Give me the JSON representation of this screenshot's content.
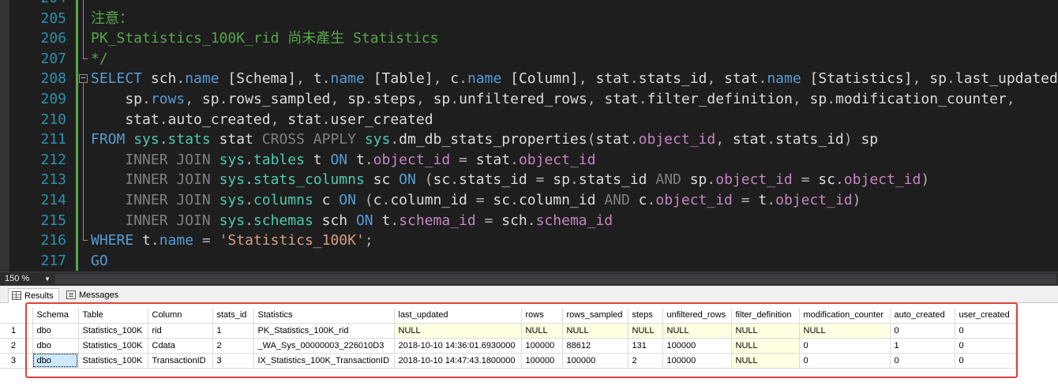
{
  "editor": {
    "lines": [
      {
        "num": "204",
        "fold": "bar",
        "tokens": [
          {
            "c": "c-com",
            "t": ""
          }
        ]
      },
      {
        "num": "205",
        "fold": "bar",
        "tokens": [
          {
            "c": "c-com",
            "t": "注意："
          }
        ]
      },
      {
        "num": "206",
        "fold": "bar",
        "tokens": [
          {
            "c": "c-com",
            "t": "PK_Statistics_100K_rid 尚未產生 Statistics"
          }
        ]
      },
      {
        "num": "207",
        "fold": "end",
        "tokens": [
          {
            "c": "c-com",
            "t": "*/"
          }
        ]
      },
      {
        "num": "208",
        "fold": "box",
        "tokens": [
          {
            "c": "c-kw",
            "t": "SELECT "
          },
          {
            "c": "c-id",
            "t": "sch"
          },
          {
            "c": "c-op",
            "t": "."
          },
          {
            "c": "c-kw",
            "t": "name"
          },
          {
            "c": "c-id",
            "t": " [Schema]"
          },
          {
            "c": "c-op",
            "t": ", "
          },
          {
            "c": "c-id",
            "t": "t"
          },
          {
            "c": "c-op",
            "t": "."
          },
          {
            "c": "c-kw",
            "t": "name"
          },
          {
            "c": "c-id",
            "t": " [Table]"
          },
          {
            "c": "c-op",
            "t": ", "
          },
          {
            "c": "c-id",
            "t": "c"
          },
          {
            "c": "c-op",
            "t": "."
          },
          {
            "c": "c-kw",
            "t": "name"
          },
          {
            "c": "c-id",
            "t": " [Column]"
          },
          {
            "c": "c-op",
            "t": ", "
          },
          {
            "c": "c-id",
            "t": "stat"
          },
          {
            "c": "c-op",
            "t": "."
          },
          {
            "c": "c-id",
            "t": "stats_id"
          },
          {
            "c": "c-op",
            "t": ", "
          },
          {
            "c": "c-id",
            "t": "stat"
          },
          {
            "c": "c-op",
            "t": "."
          },
          {
            "c": "c-kw",
            "t": "name"
          },
          {
            "c": "c-id",
            "t": " [Statistics]"
          },
          {
            "c": "c-op",
            "t": ", "
          },
          {
            "c": "c-id",
            "t": "sp"
          },
          {
            "c": "c-op",
            "t": "."
          },
          {
            "c": "c-id",
            "t": "last_updated"
          },
          {
            "c": "c-op",
            "t": ","
          }
        ]
      },
      {
        "num": "209",
        "fold": "bar",
        "tokens": [
          {
            "c": "c-id",
            "t": "    sp"
          },
          {
            "c": "c-op",
            "t": "."
          },
          {
            "c": "c-kw",
            "t": "rows"
          },
          {
            "c": "c-op",
            "t": ", "
          },
          {
            "c": "c-id",
            "t": "sp"
          },
          {
            "c": "c-op",
            "t": "."
          },
          {
            "c": "c-id",
            "t": "rows_sampled"
          },
          {
            "c": "c-op",
            "t": ", "
          },
          {
            "c": "c-id",
            "t": "sp"
          },
          {
            "c": "c-op",
            "t": "."
          },
          {
            "c": "c-id",
            "t": "steps"
          },
          {
            "c": "c-op",
            "t": ", "
          },
          {
            "c": "c-id",
            "t": "sp"
          },
          {
            "c": "c-op",
            "t": "."
          },
          {
            "c": "c-id",
            "t": "unfiltered_rows"
          },
          {
            "c": "c-op",
            "t": ", "
          },
          {
            "c": "c-id",
            "t": "stat"
          },
          {
            "c": "c-op",
            "t": "."
          },
          {
            "c": "c-id",
            "t": "filter_definition"
          },
          {
            "c": "c-op",
            "t": ", "
          },
          {
            "c": "c-id",
            "t": "sp"
          },
          {
            "c": "c-op",
            "t": "."
          },
          {
            "c": "c-id",
            "t": "modification_counter"
          },
          {
            "c": "c-op",
            "t": ","
          }
        ]
      },
      {
        "num": "210",
        "fold": "bar",
        "tokens": [
          {
            "c": "c-id",
            "t": "    stat"
          },
          {
            "c": "c-op",
            "t": "."
          },
          {
            "c": "c-id",
            "t": "auto_created"
          },
          {
            "c": "c-op",
            "t": ", "
          },
          {
            "c": "c-id",
            "t": "stat"
          },
          {
            "c": "c-op",
            "t": "."
          },
          {
            "c": "c-id",
            "t": "user_created"
          }
        ]
      },
      {
        "num": "211",
        "fold": "bar",
        "tokens": [
          {
            "c": "c-kw",
            "t": "FROM "
          },
          {
            "c": "c-sys",
            "t": "sys"
          },
          {
            "c": "c-op",
            "t": "."
          },
          {
            "c": "c-sys",
            "t": "stats"
          },
          {
            "c": "c-id",
            "t": " stat "
          },
          {
            "c": "c-gray",
            "t": "CROSS APPLY "
          },
          {
            "c": "c-sys",
            "t": "sys"
          },
          {
            "c": "c-op",
            "t": "."
          },
          {
            "c": "c-fn",
            "t": "dm_db_stats_properties"
          },
          {
            "c": "c-op",
            "t": "("
          },
          {
            "c": "c-id",
            "t": "stat"
          },
          {
            "c": "c-op",
            "t": "."
          },
          {
            "c": "c-pink",
            "t": "object_id"
          },
          {
            "c": "c-op",
            "t": ", "
          },
          {
            "c": "c-id",
            "t": "stat"
          },
          {
            "c": "c-op",
            "t": "."
          },
          {
            "c": "c-id",
            "t": "stats_id"
          },
          {
            "c": "c-op",
            "t": ")"
          },
          {
            "c": "c-id",
            "t": " sp"
          }
        ]
      },
      {
        "num": "212",
        "fold": "bar",
        "tokens": [
          {
            "c": "c-gray",
            "t": "    INNER JOIN "
          },
          {
            "c": "c-sys",
            "t": "sys"
          },
          {
            "c": "c-op",
            "t": "."
          },
          {
            "c": "c-sys",
            "t": "tables"
          },
          {
            "c": "c-id",
            "t": " t "
          },
          {
            "c": "c-kw",
            "t": "ON "
          },
          {
            "c": "c-id",
            "t": "t"
          },
          {
            "c": "c-op",
            "t": "."
          },
          {
            "c": "c-pink",
            "t": "object_id"
          },
          {
            "c": "c-op",
            "t": " = "
          },
          {
            "c": "c-id",
            "t": "stat"
          },
          {
            "c": "c-op",
            "t": "."
          },
          {
            "c": "c-pink",
            "t": "object_id"
          }
        ]
      },
      {
        "num": "213",
        "fold": "bar",
        "tokens": [
          {
            "c": "c-gray",
            "t": "    INNER JOIN "
          },
          {
            "c": "c-sys",
            "t": "sys"
          },
          {
            "c": "c-op",
            "t": "."
          },
          {
            "c": "c-sys",
            "t": "stats_columns"
          },
          {
            "c": "c-id",
            "t": " sc "
          },
          {
            "c": "c-kw",
            "t": "ON "
          },
          {
            "c": "c-op",
            "t": "("
          },
          {
            "c": "c-id",
            "t": "sc"
          },
          {
            "c": "c-op",
            "t": "."
          },
          {
            "c": "c-id",
            "t": "stats_id"
          },
          {
            "c": "c-op",
            "t": " = "
          },
          {
            "c": "c-id",
            "t": "sp"
          },
          {
            "c": "c-op",
            "t": "."
          },
          {
            "c": "c-id",
            "t": "stats_id"
          },
          {
            "c": "c-gray",
            "t": " AND "
          },
          {
            "c": "c-id",
            "t": "sp"
          },
          {
            "c": "c-op",
            "t": "."
          },
          {
            "c": "c-pink",
            "t": "object_id"
          },
          {
            "c": "c-op",
            "t": " = "
          },
          {
            "c": "c-id",
            "t": "sc"
          },
          {
            "c": "c-op",
            "t": "."
          },
          {
            "c": "c-pink",
            "t": "object_id"
          },
          {
            "c": "c-op",
            "t": ")"
          }
        ]
      },
      {
        "num": "214",
        "fold": "bar",
        "tokens": [
          {
            "c": "c-gray",
            "t": "    INNER JOIN "
          },
          {
            "c": "c-sys",
            "t": "sys"
          },
          {
            "c": "c-op",
            "t": "."
          },
          {
            "c": "c-sys",
            "t": "columns"
          },
          {
            "c": "c-id",
            "t": " c "
          },
          {
            "c": "c-kw",
            "t": "ON "
          },
          {
            "c": "c-op",
            "t": "("
          },
          {
            "c": "c-id",
            "t": "c"
          },
          {
            "c": "c-op",
            "t": "."
          },
          {
            "c": "c-id",
            "t": "column_id"
          },
          {
            "c": "c-op",
            "t": " = "
          },
          {
            "c": "c-id",
            "t": "sc"
          },
          {
            "c": "c-op",
            "t": "."
          },
          {
            "c": "c-id",
            "t": "column_id"
          },
          {
            "c": "c-gray",
            "t": " AND "
          },
          {
            "c": "c-id",
            "t": "c"
          },
          {
            "c": "c-op",
            "t": "."
          },
          {
            "c": "c-pink",
            "t": "object_id"
          },
          {
            "c": "c-op",
            "t": " = "
          },
          {
            "c": "c-id",
            "t": "t"
          },
          {
            "c": "c-op",
            "t": "."
          },
          {
            "c": "c-pink",
            "t": "object_id"
          },
          {
            "c": "c-op",
            "t": ")"
          }
        ]
      },
      {
        "num": "215",
        "fold": "bar",
        "tokens": [
          {
            "c": "c-gray",
            "t": "    INNER JOIN "
          },
          {
            "c": "c-sys",
            "t": "sys"
          },
          {
            "c": "c-op",
            "t": "."
          },
          {
            "c": "c-sys",
            "t": "schemas"
          },
          {
            "c": "c-id",
            "t": " sch "
          },
          {
            "c": "c-kw",
            "t": "ON "
          },
          {
            "c": "c-id",
            "t": "t"
          },
          {
            "c": "c-op",
            "t": "."
          },
          {
            "c": "c-pink",
            "t": "schema_id"
          },
          {
            "c": "c-op",
            "t": " = "
          },
          {
            "c": "c-id",
            "t": "sch"
          },
          {
            "c": "c-op",
            "t": "."
          },
          {
            "c": "c-pink",
            "t": "schema_id"
          }
        ]
      },
      {
        "num": "216",
        "fold": "end",
        "tokens": [
          {
            "c": "c-kw",
            "t": "WHERE "
          },
          {
            "c": "c-id",
            "t": "t"
          },
          {
            "c": "c-op",
            "t": "."
          },
          {
            "c": "c-kw",
            "t": "name"
          },
          {
            "c": "c-op",
            "t": " = "
          },
          {
            "c": "c-str",
            "t": "'Statistics_100K'"
          },
          {
            "c": "c-op",
            "t": ";"
          }
        ]
      },
      {
        "num": "217",
        "fold": "none",
        "tokens": [
          {
            "c": "c-kw",
            "t": "GO"
          }
        ]
      }
    ]
  },
  "zoom": {
    "value": "150 %"
  },
  "results": {
    "tabs": [
      {
        "label": "Results",
        "icon": "results-grid-icon",
        "active": true
      },
      {
        "label": "Messages",
        "icon": "messages-icon",
        "active": false
      }
    ],
    "columns": [
      "Schema",
      "Table",
      "Column",
      "stats_id",
      "Statistics",
      "last_updated",
      "rows",
      "rows_sampled",
      "steps",
      "unfiltered_rows",
      "filter_definition",
      "modification_counter",
      "auto_created",
      "user_created"
    ],
    "rows": [
      {
        "num": "1",
        "cells": [
          "dbo",
          "Statistics_100K",
          "rid",
          "1",
          "PK_Statistics_100K_rid",
          "NULL",
          "NULL",
          "NULL",
          "NULL",
          "NULL",
          "NULL",
          "NULL",
          "0",
          "0"
        ]
      },
      {
        "num": "2",
        "cells": [
          "dbo",
          "Statistics_100K",
          "Cdata",
          "2",
          "_WA_Sys_00000003_226010D3",
          "2018-10-10 14:36:01.6930000",
          "100000",
          "88612",
          "131",
          "100000",
          "NULL",
          "0",
          "1",
          "0"
        ]
      },
      {
        "num": "3",
        "cells": [
          "dbo",
          "Statistics_100K",
          "TransactionID",
          "3",
          "IX_Statistics_100K_TransactionID",
          "2018-10-10 14:47:43.1800000",
          "100000",
          "100000",
          "2",
          "100000",
          "NULL",
          "0",
          "0",
          "0"
        ]
      }
    ],
    "selected_cell": {
      "row": 3,
      "col": 1
    }
  },
  "colors": {
    "highlight_box": "#e0413b",
    "null_cell": "#ffffe1",
    "selected_cell": "#cce8ff"
  }
}
